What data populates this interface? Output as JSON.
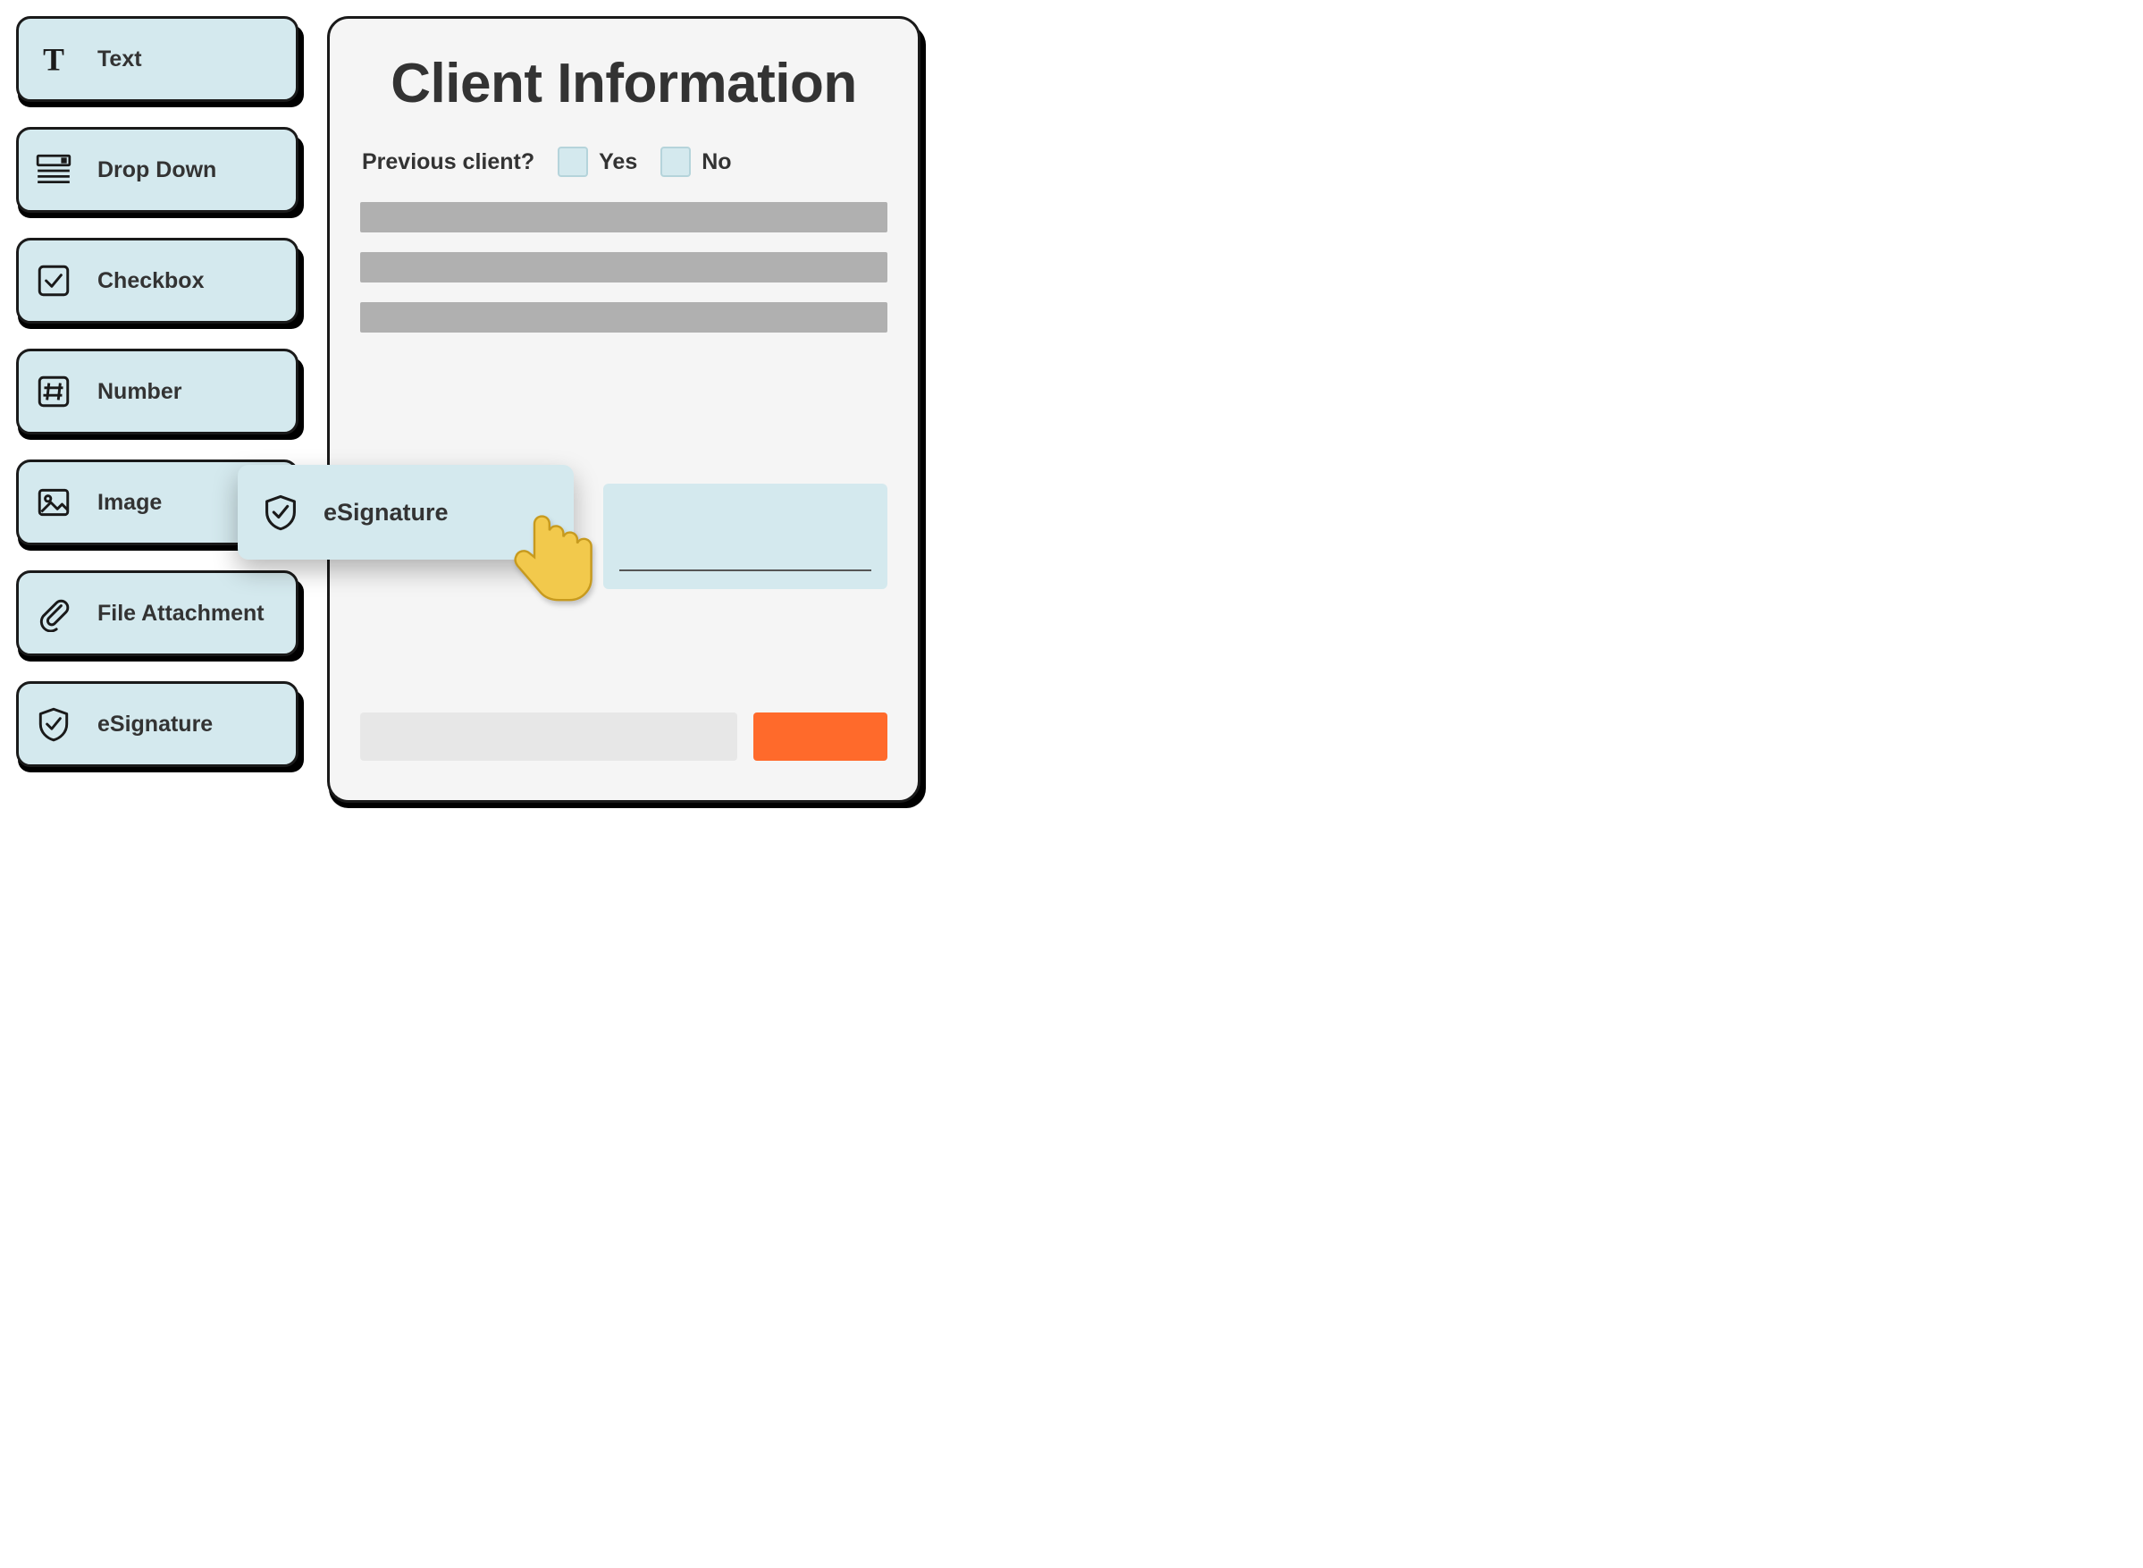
{
  "sidebar": {
    "tiles": [
      {
        "label": "Text",
        "icon": "text-icon"
      },
      {
        "label": "Drop Down",
        "icon": "dropdown-icon"
      },
      {
        "label": "Checkbox",
        "icon": "checkbox-icon"
      },
      {
        "label": "Number",
        "icon": "number-icon"
      },
      {
        "label": "Image",
        "icon": "image-icon"
      },
      {
        "label": "File Attachment",
        "icon": "attachment-icon"
      },
      {
        "label": "eSignature",
        "icon": "esignature-icon"
      }
    ]
  },
  "drag": {
    "label": "eSignature",
    "icon": "esignature-icon"
  },
  "form": {
    "title": "Client Information",
    "question": "Previous client?",
    "options": [
      {
        "label": "Yes"
      },
      {
        "label": "No"
      }
    ],
    "placeholder_lines": 3,
    "submit_color": "#ff6a2b"
  },
  "icons": {
    "text-icon": "T",
    "dropdown-icon": "dropdown",
    "checkbox-icon": "checkbox",
    "number-icon": "#",
    "image-icon": "image",
    "attachment-icon": "clip",
    "esignature-icon": "shield"
  }
}
